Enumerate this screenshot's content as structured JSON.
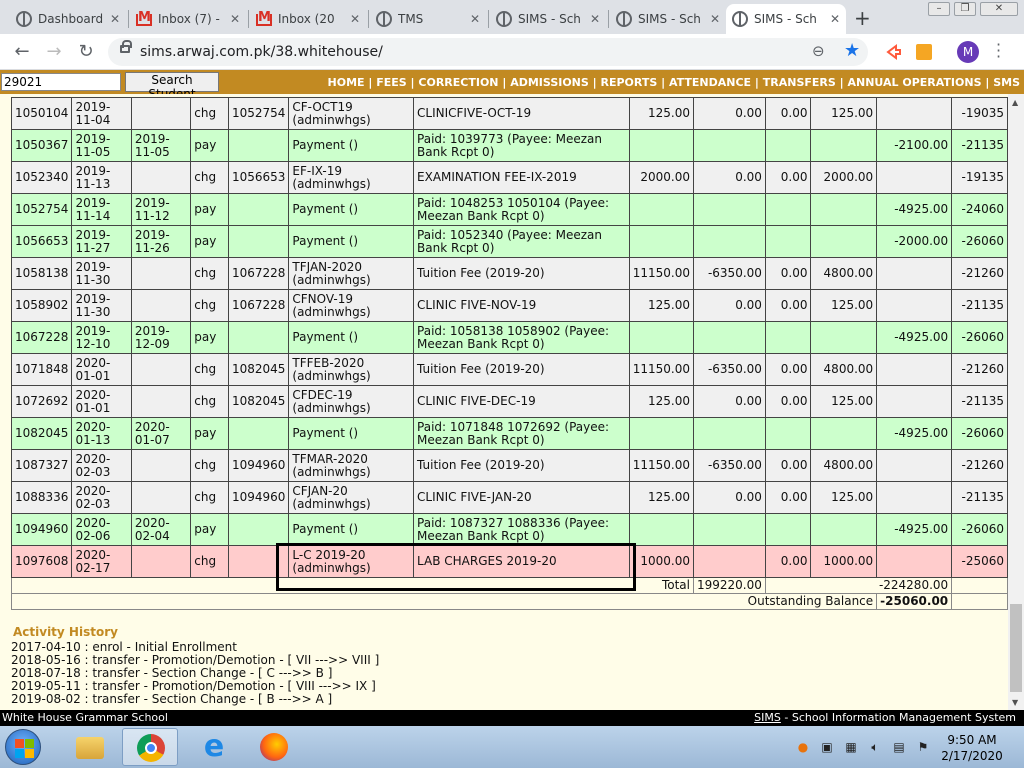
{
  "browser": {
    "tabs": [
      {
        "title": "Dashboard",
        "icon": "globe-icon"
      },
      {
        "title": "Inbox (7) -",
        "icon": "gmail-icon"
      },
      {
        "title": "Inbox (20",
        "icon": "gmail-icon"
      },
      {
        "title": "TMS",
        "icon": "globe-icon"
      },
      {
        "title": "SIMS - Sch",
        "icon": "globe-icon"
      },
      {
        "title": "SIMS - Sch",
        "icon": "globe-icon"
      },
      {
        "title": "SIMS - Sch",
        "icon": "globe-icon",
        "active": true
      }
    ],
    "new_tab": "+",
    "url": "sims.arwaj.com.pk/38.whitehouse/",
    "profile_initial": "M"
  },
  "app": {
    "search_value": "29021",
    "search_button": "Search Student",
    "nav": [
      "HOME",
      "FEES",
      "CORRECTION",
      "ADMISSIONS",
      "REPORTS",
      "ATTENDANCE",
      "TRANSFERS",
      "ANNUAL OPERATIONS",
      "SMS"
    ],
    "nav_sep": " | "
  },
  "ledger": {
    "rows": [
      {
        "type": "chg",
        "cells": [
          "1050104",
          "2019-11-04",
          "",
          "chg",
          "1052754",
          "CF-OCT19 (adminwhgs)",
          "CLINICFIVE-OCT-19",
          "125.00",
          "0.00",
          "0.00",
          "125.00",
          "",
          "-19035"
        ]
      },
      {
        "type": "pay",
        "cells": [
          "1050367",
          "2019-11-05",
          "2019-11-05",
          "pay",
          "",
          "Payment ()",
          "Paid: 1039773 (Payee: Meezan Bank Rcpt 0)",
          "",
          "",
          "",
          "",
          "-2100.00",
          "-21135"
        ]
      },
      {
        "type": "chg",
        "cells": [
          "1052340",
          "2019-11-13",
          "",
          "chg",
          "1056653",
          "EF-IX-19 (adminwhgs)",
          "EXAMINATION FEE-IX-2019",
          "2000.00",
          "0.00",
          "0.00",
          "2000.00",
          "",
          "-19135"
        ]
      },
      {
        "type": "pay",
        "cells": [
          "1052754",
          "2019-11-14",
          "2019-11-12",
          "pay",
          "",
          "Payment ()",
          "Paid: 1048253 1050104 (Payee: Meezan Bank Rcpt 0)",
          "",
          "",
          "",
          "",
          "-4925.00",
          "-24060"
        ]
      },
      {
        "type": "pay",
        "cells": [
          "1056653",
          "2019-11-27",
          "2019-11-26",
          "pay",
          "",
          "Payment ()",
          "Paid: 1052340 (Payee: Meezan Bank Rcpt 0)",
          "",
          "",
          "",
          "",
          "-2000.00",
          "-26060"
        ]
      },
      {
        "type": "chg",
        "cells": [
          "1058138",
          "2019-11-30",
          "",
          "chg",
          "1067228",
          "TFJAN-2020 (adminwhgs)",
          "Tuition Fee (2019-20)",
          "11150.00",
          "-6350.00",
          "0.00",
          "4800.00",
          "",
          "-21260"
        ]
      },
      {
        "type": "chg",
        "cells": [
          "1058902",
          "2019-11-30",
          "",
          "chg",
          "1067228",
          "CFNOV-19 (adminwhgs)",
          "CLINIC FIVE-NOV-19",
          "125.00",
          "0.00",
          "0.00",
          "125.00",
          "",
          "-21135"
        ]
      },
      {
        "type": "pay",
        "cells": [
          "1067228",
          "2019-12-10",
          "2019-12-09",
          "pay",
          "",
          "Payment ()",
          "Paid: 1058138 1058902 (Payee: Meezan Bank Rcpt 0)",
          "",
          "",
          "",
          "",
          "-4925.00",
          "-26060"
        ]
      },
      {
        "type": "chg",
        "cells": [
          "1071848",
          "2020-01-01",
          "",
          "chg",
          "1082045",
          "TFFEB-2020 (adminwhgs)",
          "Tuition Fee (2019-20)",
          "11150.00",
          "-6350.00",
          "0.00",
          "4800.00",
          "",
          "-21260"
        ]
      },
      {
        "type": "chg",
        "cells": [
          "1072692",
          "2020-01-01",
          "",
          "chg",
          "1082045",
          "CFDEC-19 (adminwhgs)",
          "CLINIC FIVE-DEC-19",
          "125.00",
          "0.00",
          "0.00",
          "125.00",
          "",
          "-21135"
        ]
      },
      {
        "type": "pay",
        "cells": [
          "1082045",
          "2020-01-13",
          "2020-01-07",
          "pay",
          "",
          "Payment ()",
          "Paid: 1071848 1072692 (Payee: Meezan Bank Rcpt 0)",
          "",
          "",
          "",
          "",
          "-4925.00",
          "-26060"
        ]
      },
      {
        "type": "chg",
        "cells": [
          "1087327",
          "2020-02-03",
          "",
          "chg",
          "1094960",
          "TFMAR-2020 (adminwhgs)",
          "Tuition Fee (2019-20)",
          "11150.00",
          "-6350.00",
          "0.00",
          "4800.00",
          "",
          "-21260"
        ]
      },
      {
        "type": "chg",
        "cells": [
          "1088336",
          "2020-02-03",
          "",
          "chg",
          "1094960",
          "CFJAN-20 (adminwhgs)",
          "CLINIC FIVE-JAN-20",
          "125.00",
          "0.00",
          "0.00",
          "125.00",
          "",
          "-21135"
        ]
      },
      {
        "type": "pay",
        "cells": [
          "1094960",
          "2020-02-06",
          "2020-02-04",
          "pay",
          "",
          "Payment ()",
          "Paid: 1087327 1088336 (Payee: Meezan Bank Rcpt 0)",
          "",
          "",
          "",
          "",
          "-4925.00",
          "-26060"
        ]
      },
      {
        "type": "hl",
        "cells": [
          "1097608",
          "2020-02-17",
          "",
          "chg",
          "",
          "L-C 2019-20 (adminwhgs)",
          "LAB CHARGES 2019-20",
          "1000.00",
          "",
          "0.00",
          "1000.00",
          "",
          "-25060"
        ]
      }
    ],
    "total_label": "Total",
    "total_charges": "199220.00",
    "total_paid": "-224280.00",
    "outstanding_label": "Outstanding Balance",
    "outstanding_value": "-25060.00"
  },
  "activity": {
    "title": "Activity History",
    "items": [
      "2017-04-10 : enrol - Initial Enrollment",
      "2018-05-16 : transfer - Promotion/Demotion - [ VII --->> VIII ]",
      "2018-07-18 : transfer - Section Change - [ C --->> B ]",
      "2019-05-11 : transfer - Promotion/Demotion - [ VIII --->> IX ]",
      "2019-08-02 : transfer - Section Change - [ B --->> A ]"
    ]
  },
  "status": {
    "school": "White House Grammar School",
    "system_abbr": "SIMS",
    "system_name": " - School Information Management System"
  },
  "taskbar": {
    "time": "9:50 AM",
    "date": "2/17/2020"
  }
}
